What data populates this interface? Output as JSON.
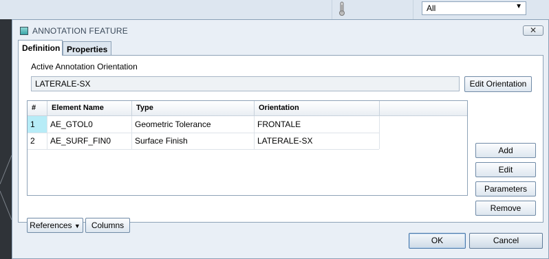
{
  "background": {
    "filter_value": "All",
    "icon": "thermometer-icon"
  },
  "dialog": {
    "title": "ANNOTATION FEATURE",
    "close_icon": "close-icon",
    "tabs": [
      {
        "label": "Definition",
        "active": true
      },
      {
        "label": "Properties",
        "active": false
      }
    ],
    "orientation_group": {
      "label": "Active Annotation Orientation",
      "value": "LATERALE-SX",
      "edit_button": "Edit Orientation"
    },
    "table": {
      "columns": [
        "#",
        "Element Name",
        "Type",
        "Orientation"
      ],
      "rows": [
        {
          "num": "1",
          "name": "AE_GTOL0",
          "type": "Geometric Tolerance",
          "orientation": "FRONTALE"
        },
        {
          "num": "2",
          "name": "AE_SURF_FIN0",
          "type": "Surface Finish",
          "orientation": "LATERALE-SX"
        }
      ]
    },
    "side_buttons": {
      "add": "Add",
      "edit": "Edit",
      "parameters": "Parameters",
      "remove": "Remove"
    },
    "references_button": "References",
    "columns_button": "Columns",
    "ok_button": "OK",
    "cancel_button": "Cancel"
  },
  "colors": {
    "selection": "#b7ecf7",
    "dialog_bg": "#e9eff6"
  }
}
